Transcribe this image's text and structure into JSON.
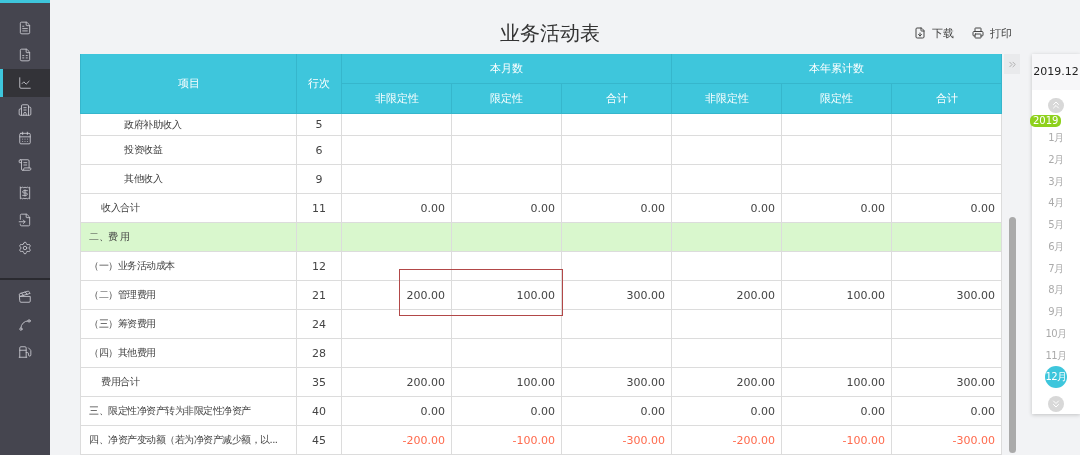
{
  "sidebar": {
    "items": [
      {
        "kind": "ledger",
        "selected": false
      },
      {
        "kind": "voucher",
        "selected": false
      },
      {
        "kind": "chart",
        "selected": true
      },
      {
        "kind": "building",
        "selected": false
      },
      {
        "kind": "calendar",
        "selected": false
      },
      {
        "kind": "scroll",
        "selected": false
      },
      {
        "kind": "receipt",
        "selected": false
      },
      {
        "kind": "file",
        "selected": false
      },
      {
        "kind": "settings",
        "selected": false
      },
      {
        "kind": "divider"
      },
      {
        "kind": "video",
        "selected": false
      },
      {
        "kind": "curve",
        "selected": false
      },
      {
        "kind": "fuel",
        "selected": false
      }
    ]
  },
  "title": "业务活动表",
  "actions": [
    {
      "kind": "download",
      "label": "下载"
    },
    {
      "kind": "print",
      "label": "打印"
    }
  ],
  "table": {
    "columns": [
      {
        "label": "项目"
      },
      {
        "label": "行次"
      }
    ],
    "groups": [
      {
        "label": "本月数",
        "columns": [
          "非限定性",
          "限定性",
          "合计"
        ]
      },
      {
        "label": "本年累计数",
        "columns": [
          "非限定性",
          "限定性",
          "合计"
        ]
      }
    ],
    "rows": [
      {
        "kind": "sub",
        "item": "政府补助收入",
        "line": "5"
      },
      {
        "kind": "sub",
        "item": "投资收益",
        "line": "6"
      },
      {
        "kind": "sub",
        "item": "其他收入",
        "line": "9"
      },
      {
        "kind": "total",
        "item": "收入合计",
        "line": "11",
        "values": [
          "0.00",
          "0.00",
          "0.00",
          "0.00",
          "0.00",
          "0.00"
        ]
      },
      {
        "kind": "section",
        "item": "二、费 用"
      },
      {
        "kind": "item",
        "item": "（一）业务活动成本",
        "line": "12"
      },
      {
        "kind": "item",
        "item": "（二）管理费用",
        "line": "21",
        "values": [
          "200.00",
          "100.00",
          "300.00",
          "200.00",
          "100.00",
          "300.00"
        ]
      },
      {
        "kind": "item",
        "item": "（三）筹资费用",
        "line": "24"
      },
      {
        "kind": "item",
        "item": "（四）其他费用",
        "line": "28"
      },
      {
        "kind": "total",
        "item": "费用合计",
        "line": "35",
        "values": [
          "200.00",
          "100.00",
          "300.00",
          "200.00",
          "100.00",
          "300.00"
        ]
      },
      {
        "kind": "item",
        "item": "三、限定性净资产转为非限定性净资产",
        "line": "40",
        "values": [
          "0.00",
          "0.00",
          "0.00",
          "0.00",
          "0.00",
          "0.00"
        ]
      },
      {
        "kind": "item",
        "item": "四、净资产变动额（若为净资产减少额，以...",
        "line": "45",
        "values": [
          "-200.00",
          "-100.00",
          "-300.00",
          "-200.00",
          "-100.00",
          "-300.00"
        ],
        "negative": true
      }
    ]
  },
  "period": {
    "current": "2019.12",
    "year": "2019",
    "months": [
      {
        "label": "1月",
        "selected": false
      },
      {
        "label": "2月",
        "selected": false
      },
      {
        "label": "3月",
        "selected": false
      },
      {
        "label": "4月",
        "selected": false
      },
      {
        "label": "5月",
        "selected": false
      },
      {
        "label": "6月",
        "selected": false
      },
      {
        "label": "7月",
        "selected": false
      },
      {
        "label": "8月",
        "selected": false
      },
      {
        "label": "9月",
        "selected": false
      },
      {
        "label": "10月",
        "selected": false
      },
      {
        "label": "11月",
        "selected": false
      },
      {
        "label": "12月",
        "selected": true
      }
    ]
  }
}
